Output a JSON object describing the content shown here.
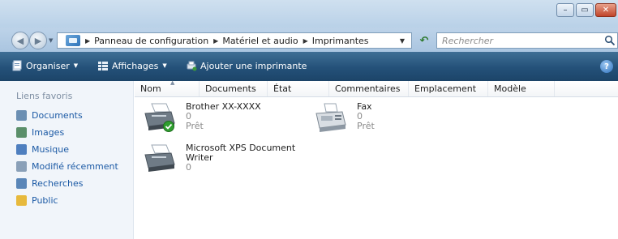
{
  "window": {
    "buttons": {
      "minimize": "–",
      "maximize": "▭",
      "close": "✕"
    }
  },
  "address": {
    "breadcrumb": [
      "Panneau de configuration",
      "Matériel et audio",
      "Imprimantes"
    ],
    "search_placeholder": "Rechercher"
  },
  "toolbar": {
    "organize": "Organiser",
    "views": "Affichages",
    "add_printer": "Ajouter une imprimante"
  },
  "sidebar": {
    "title": "Liens favoris",
    "items": [
      {
        "label": "Documents",
        "icon": "documents-icon",
        "color": "#6b8fb3"
      },
      {
        "label": "Images",
        "icon": "pictures-icon",
        "color": "#5b8f6a"
      },
      {
        "label": "Musique",
        "icon": "music-icon",
        "color": "#4f7fbf"
      },
      {
        "label": "Modifié récemment",
        "icon": "recent-icon",
        "color": "#8aa0b8"
      },
      {
        "label": "Recherches",
        "icon": "searches-icon",
        "color": "#5a86b8"
      },
      {
        "label": "Public",
        "icon": "public-folder-icon",
        "color": "#e7b93c"
      }
    ]
  },
  "columns": [
    "Nom",
    "Documents",
    "État",
    "Commentaires",
    "Emplacement",
    "Modèle"
  ],
  "printers": [
    {
      "name": "Brother XX-XXXX",
      "documents": "0",
      "status": "Prêt",
      "default": true
    },
    {
      "name": "Fax",
      "documents": "0",
      "status": "Prêt",
      "default": false
    },
    {
      "name_line1": "Microsoft XPS Document",
      "name_line2": "Writer",
      "documents": "0",
      "default": false
    }
  ],
  "colors": {
    "command_bar": "#245179",
    "link": "#1c5aa5",
    "default_check": "#2f9e2f"
  }
}
